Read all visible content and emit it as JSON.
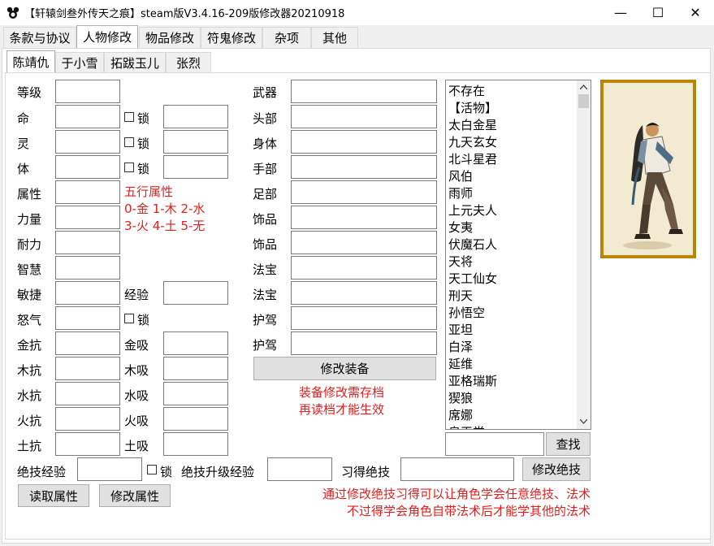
{
  "window": {
    "title": "【轩辕剑叁外传天之痕】steam版V3.4.16-209版修改器20210918",
    "minimize_glyph": "—",
    "maximize_glyph": "☐",
    "close_glyph": "✕"
  },
  "main_tabs": [
    "条款与协议",
    "人物修改",
    "物品修改",
    "符鬼修改",
    "杂项",
    "其他"
  ],
  "selected_main_tab": "人物修改",
  "character_tabs": [
    "陈靖仇",
    "于小雪",
    "拓跋玉儿",
    "张烈"
  ],
  "selected_character_tab": "陈靖仇",
  "stats": {
    "level": "等级",
    "life": "命",
    "spirit": "灵",
    "body": "体",
    "attribute": "属性",
    "strength": "力量",
    "endurance": "耐力",
    "wisdom": "智慧",
    "agility": "敏捷",
    "rage": "怒气",
    "experience": "经验",
    "lock": "锁",
    "metal_resist": "金抗",
    "wood_resist": "木抗",
    "water_resist": "水抗",
    "fire_resist": "火抗",
    "earth_resist": "土抗",
    "metal_absorb": "金吸",
    "wood_absorb": "木吸",
    "water_absorb": "水吸",
    "fire_absorb": "火吸",
    "earth_absorb": "土吸"
  },
  "element_note": {
    "line1": "五行属性",
    "line2": "0-金 1-木 2-水",
    "line3": "3-火 4-土 5-无"
  },
  "equipment": {
    "weapon": "武器",
    "head": "头部",
    "body": "身体",
    "hand": "手部",
    "foot": "足部",
    "accessory1": "饰品",
    "accessory2": "饰品",
    "treasure1": "法宝",
    "treasure2": "法宝",
    "guardian1": "护驾",
    "guardian2": "护驾",
    "modify_button": "修改装备",
    "note_line1": "装备修改需存档",
    "note_line2": "再读档才能生效"
  },
  "item_list": [
    "不存在",
    "【活物】",
    "太白金星",
    "九天玄女",
    "北斗星君",
    "风伯",
    "雨师",
    "上元夫人",
    "女夷",
    "伏魔石人",
    "天将",
    "天工仙女",
    "刑天",
    "孙悟空",
    "亚坦",
    "白泽",
    "延维",
    "亚格瑞斯",
    "猰狼",
    "席娜",
    "皇天堂"
  ],
  "search_button": "查找",
  "skills": {
    "skill_exp": "绝技经验",
    "lock": "锁",
    "skill_upgrade_exp": "绝技升级经验",
    "learned_skill": "习得绝技",
    "modify_skill_button": "修改绝技",
    "note_line1": "通过修改绝技习得可以让角色学会任意绝技、法术",
    "note_line2": "不过得学会角色自带法术后才能学其他的法术"
  },
  "bottom_buttons": {
    "read": "读取属性",
    "modify": "修改属性"
  },
  "colors": {
    "note_red": "#e02020",
    "frame_gold": "#b8860b"
  }
}
